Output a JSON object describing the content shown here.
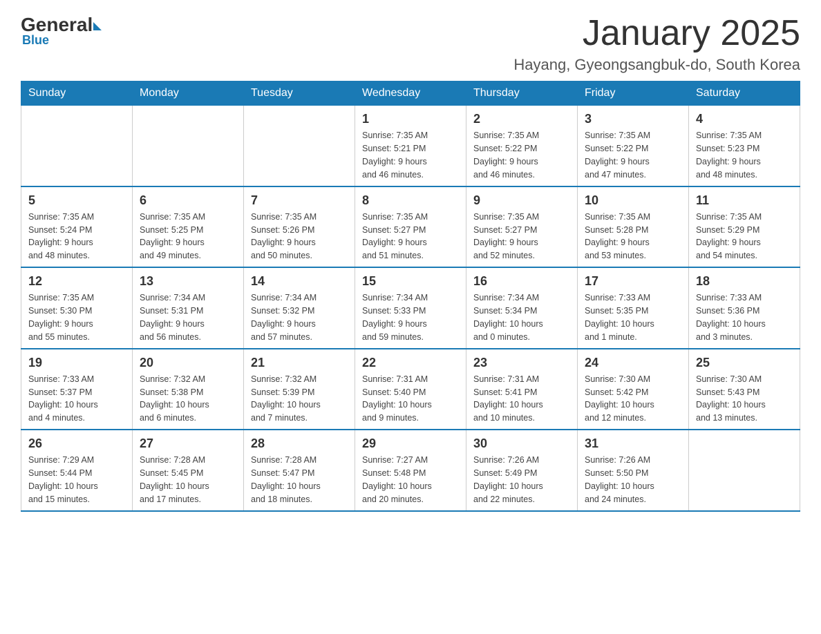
{
  "header": {
    "logo": {
      "general": "General",
      "blue": "Blue"
    },
    "title": "January 2025",
    "location": "Hayang, Gyeongsangbuk-do, South Korea"
  },
  "weekdays": [
    "Sunday",
    "Monday",
    "Tuesday",
    "Wednesday",
    "Thursday",
    "Friday",
    "Saturday"
  ],
  "weeks": [
    [
      {
        "day": "",
        "info": ""
      },
      {
        "day": "",
        "info": ""
      },
      {
        "day": "",
        "info": ""
      },
      {
        "day": "1",
        "info": "Sunrise: 7:35 AM\nSunset: 5:21 PM\nDaylight: 9 hours\nand 46 minutes."
      },
      {
        "day": "2",
        "info": "Sunrise: 7:35 AM\nSunset: 5:22 PM\nDaylight: 9 hours\nand 46 minutes."
      },
      {
        "day": "3",
        "info": "Sunrise: 7:35 AM\nSunset: 5:22 PM\nDaylight: 9 hours\nand 47 minutes."
      },
      {
        "day": "4",
        "info": "Sunrise: 7:35 AM\nSunset: 5:23 PM\nDaylight: 9 hours\nand 48 minutes."
      }
    ],
    [
      {
        "day": "5",
        "info": "Sunrise: 7:35 AM\nSunset: 5:24 PM\nDaylight: 9 hours\nand 48 minutes."
      },
      {
        "day": "6",
        "info": "Sunrise: 7:35 AM\nSunset: 5:25 PM\nDaylight: 9 hours\nand 49 minutes."
      },
      {
        "day": "7",
        "info": "Sunrise: 7:35 AM\nSunset: 5:26 PM\nDaylight: 9 hours\nand 50 minutes."
      },
      {
        "day": "8",
        "info": "Sunrise: 7:35 AM\nSunset: 5:27 PM\nDaylight: 9 hours\nand 51 minutes."
      },
      {
        "day": "9",
        "info": "Sunrise: 7:35 AM\nSunset: 5:27 PM\nDaylight: 9 hours\nand 52 minutes."
      },
      {
        "day": "10",
        "info": "Sunrise: 7:35 AM\nSunset: 5:28 PM\nDaylight: 9 hours\nand 53 minutes."
      },
      {
        "day": "11",
        "info": "Sunrise: 7:35 AM\nSunset: 5:29 PM\nDaylight: 9 hours\nand 54 minutes."
      }
    ],
    [
      {
        "day": "12",
        "info": "Sunrise: 7:35 AM\nSunset: 5:30 PM\nDaylight: 9 hours\nand 55 minutes."
      },
      {
        "day": "13",
        "info": "Sunrise: 7:34 AM\nSunset: 5:31 PM\nDaylight: 9 hours\nand 56 minutes."
      },
      {
        "day": "14",
        "info": "Sunrise: 7:34 AM\nSunset: 5:32 PM\nDaylight: 9 hours\nand 57 minutes."
      },
      {
        "day": "15",
        "info": "Sunrise: 7:34 AM\nSunset: 5:33 PM\nDaylight: 9 hours\nand 59 minutes."
      },
      {
        "day": "16",
        "info": "Sunrise: 7:34 AM\nSunset: 5:34 PM\nDaylight: 10 hours\nand 0 minutes."
      },
      {
        "day": "17",
        "info": "Sunrise: 7:33 AM\nSunset: 5:35 PM\nDaylight: 10 hours\nand 1 minute."
      },
      {
        "day": "18",
        "info": "Sunrise: 7:33 AM\nSunset: 5:36 PM\nDaylight: 10 hours\nand 3 minutes."
      }
    ],
    [
      {
        "day": "19",
        "info": "Sunrise: 7:33 AM\nSunset: 5:37 PM\nDaylight: 10 hours\nand 4 minutes."
      },
      {
        "day": "20",
        "info": "Sunrise: 7:32 AM\nSunset: 5:38 PM\nDaylight: 10 hours\nand 6 minutes."
      },
      {
        "day": "21",
        "info": "Sunrise: 7:32 AM\nSunset: 5:39 PM\nDaylight: 10 hours\nand 7 minutes."
      },
      {
        "day": "22",
        "info": "Sunrise: 7:31 AM\nSunset: 5:40 PM\nDaylight: 10 hours\nand 9 minutes."
      },
      {
        "day": "23",
        "info": "Sunrise: 7:31 AM\nSunset: 5:41 PM\nDaylight: 10 hours\nand 10 minutes."
      },
      {
        "day": "24",
        "info": "Sunrise: 7:30 AM\nSunset: 5:42 PM\nDaylight: 10 hours\nand 12 minutes."
      },
      {
        "day": "25",
        "info": "Sunrise: 7:30 AM\nSunset: 5:43 PM\nDaylight: 10 hours\nand 13 minutes."
      }
    ],
    [
      {
        "day": "26",
        "info": "Sunrise: 7:29 AM\nSunset: 5:44 PM\nDaylight: 10 hours\nand 15 minutes."
      },
      {
        "day": "27",
        "info": "Sunrise: 7:28 AM\nSunset: 5:45 PM\nDaylight: 10 hours\nand 17 minutes."
      },
      {
        "day": "28",
        "info": "Sunrise: 7:28 AM\nSunset: 5:47 PM\nDaylight: 10 hours\nand 18 minutes."
      },
      {
        "day": "29",
        "info": "Sunrise: 7:27 AM\nSunset: 5:48 PM\nDaylight: 10 hours\nand 20 minutes."
      },
      {
        "day": "30",
        "info": "Sunrise: 7:26 AM\nSunset: 5:49 PM\nDaylight: 10 hours\nand 22 minutes."
      },
      {
        "day": "31",
        "info": "Sunrise: 7:26 AM\nSunset: 5:50 PM\nDaylight: 10 hours\nand 24 minutes."
      },
      {
        "day": "",
        "info": ""
      }
    ]
  ]
}
